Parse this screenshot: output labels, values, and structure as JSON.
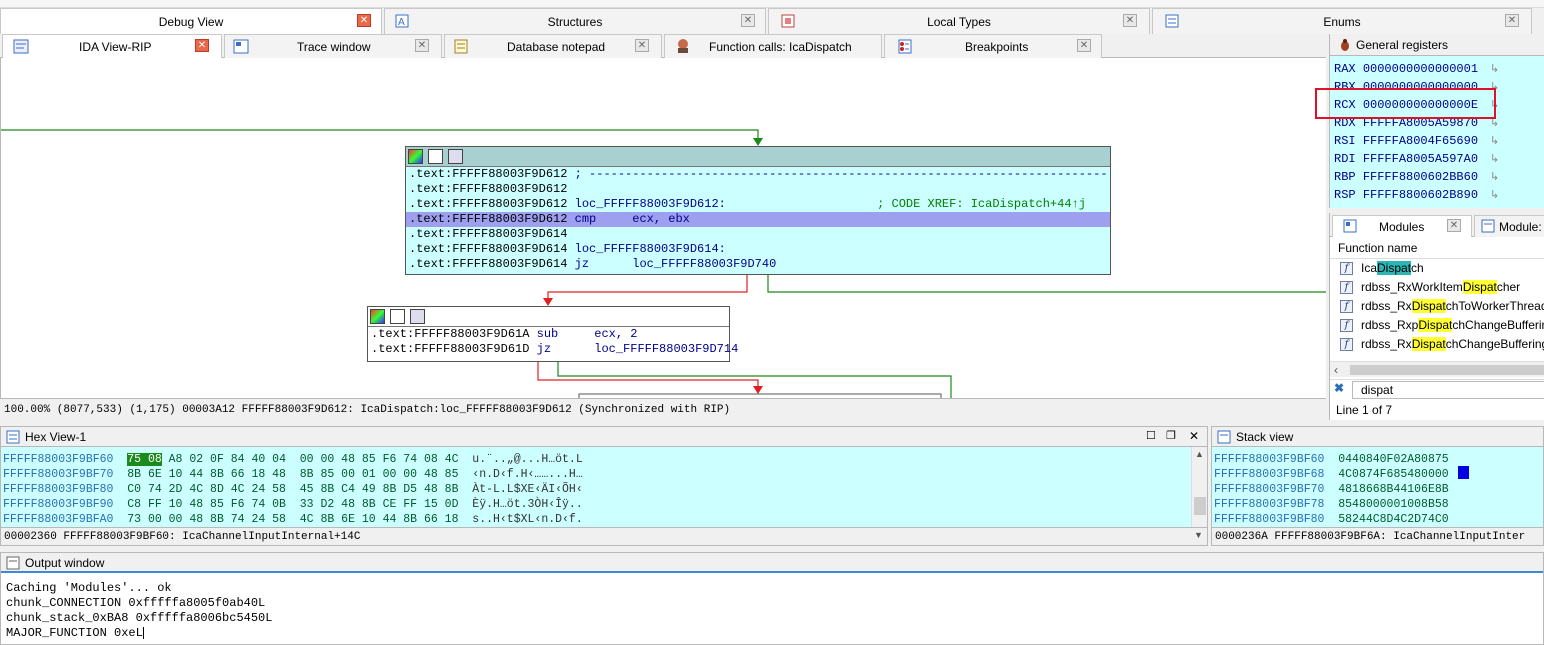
{
  "top_tabs": [
    {
      "label": "Debug View",
      "active": true
    },
    {
      "label": "Structures"
    },
    {
      "label": "Local Types"
    },
    {
      "label": "Enums"
    }
  ],
  "sub_tabs": [
    {
      "label": "IDA View-RIP",
      "active": true
    },
    {
      "label": "Trace window"
    },
    {
      "label": "Database notepad"
    },
    {
      "label": "Function calls: IcaDispatch"
    },
    {
      "label": "Breakpoints"
    }
  ],
  "graph": {
    "node1": [
      {
        "addr": ".text:FFFFF88003F9D612",
        "rest": " ; ------------------------------------------------------------------------"
      },
      {
        "addr": ".text:FFFFF88003F9D612",
        "rest": ""
      },
      {
        "addr": ".text:FFFFF88003F9D612",
        "rest": " loc_FFFFF88003F9D612:",
        "comment": "                     ; CODE XREF: IcaDispatch+44↑j"
      },
      {
        "addr": ".text:FFFFF88003F9D612",
        "rest": " cmp     ecx, ebx",
        "selected": true
      },
      {
        "addr": ".text:FFFFF88003F9D614",
        "rest": ""
      },
      {
        "addr": ".text:FFFFF88003F9D614",
        "rest": " loc_FFFFF88003F9D614:"
      },
      {
        "addr": ".text:FFFFF88003F9D614",
        "rest": " jz      loc_FFFFF88003F9D740"
      }
    ],
    "node2": [
      {
        "addr": ".text:FFFFF88003F9D61A",
        "rest": " sub     ecx, 2"
      },
      {
        "addr": ".text:FFFFF88003F9D61D",
        "rest": " jz      loc_FFFFF88003F9D714"
      }
    ],
    "status": "100.00% (8077,533) (1,175) 00003A12 FFFFF88003F9D612: IcaDispatch:loc_FFFFF88003F9D612 (Synchronized with RIP)"
  },
  "registers": {
    "title": "General registers",
    "rows": [
      {
        "name": "RAX",
        "value": "0000000000000001"
      },
      {
        "name": "RBX",
        "value": "0000000000000000"
      },
      {
        "name": "RCX",
        "value": "000000000000000E"
      },
      {
        "name": "RDX",
        "value": "FFFFFA8005A59870"
      },
      {
        "name": "RSI",
        "value": "FFFFFA8004F65690"
      },
      {
        "name": "RDI",
        "value": "FFFFFA8005A597A0"
      },
      {
        "name": "RBP",
        "value": "FFFFF8800602BB60"
      },
      {
        "name": "RSP",
        "value": "FFFFF8800602B890"
      }
    ]
  },
  "modules": {
    "tab1": "Modules",
    "tab2": "Module: I",
    "header": "Function name",
    "rows": [
      {
        "pre": "Ica",
        "hl": "Dispat",
        "post": "ch",
        "hlclass": "hlc"
      },
      {
        "pre": "rdbss_RxWorkItem",
        "hl": "Dispat",
        "post": "cher",
        "hlclass": "hl"
      },
      {
        "pre": "rdbss_Rx",
        "hl": "Dispat",
        "post": "chToWorkerThread",
        "hlclass": "hl"
      },
      {
        "pre": "rdbss_Rxp",
        "hl": "Dispat",
        "post": "chChangeBuffering",
        "hlclass": "hl"
      },
      {
        "pre": "rdbss_Rx",
        "hl": "Dispat",
        "post": "chChangeBufferingS",
        "hlclass": "hl"
      }
    ],
    "filter": "dispat",
    "line_info": "Line 1 of 7"
  },
  "hex": {
    "title": "Hex View-1",
    "rows": [
      {
        "addr": "FFFFF88003F9BF60",
        "sel": "75 08",
        "bytes": " A8 02 0F 84 40 04  00 00 48 85 F6 74 08 4C",
        "ascii": "u.¨..„@...H…öt.L"
      },
      {
        "addr": "FFFFF88003F9BF70",
        "sel": "",
        "bytes": "8B 6E 10 44 8B 66 18 48  8B 85 00 01 00 00 48 85",
        "ascii": "‹n.D‹f.H‹……...H…"
      },
      {
        "addr": "FFFFF88003F9BF80",
        "sel": "",
        "bytes": "C0 74 2D 4C 8D 4C 24 58  45 8B C4 49 8B D5 48 8B",
        "ascii": "Àt-L.L$XE‹ÄI‹ÕH‹"
      },
      {
        "addr": "FFFFF88003F9BF90",
        "sel": "",
        "bytes": "C8 FF 10 48 85 F6 74 0B  33 D2 48 8B CE FF 15 0D",
        "ascii": "Èÿ.H…öt.3ÒH‹Îÿ.."
      },
      {
        "addr": "FFFFF88003F9BFA0",
        "sel": "",
        "bytes": "73 00 00 48 8B 74 24 58  4C 8B 6E 10 44 8B 66 18",
        "ascii": "s..H‹t$XL‹n.D‹f."
      }
    ],
    "status": "00002360 FFFFF88003F9BF60: IcaChannelInputInternal+14C"
  },
  "stack": {
    "title": "Stack view",
    "rows": [
      {
        "addr": "FFFFF88003F9BF60",
        "value": "0440840F02A80875"
      },
      {
        "addr": "FFFFF88003F9BF68",
        "value": "4C0874F685480000"
      },
      {
        "addr": "FFFFF88003F9BF70",
        "value": "4818668B44106E8B"
      },
      {
        "addr": "FFFFF88003F9BF78",
        "value": "8548000001008B58"
      },
      {
        "addr": "FFFFF88003F9BF80",
        "value": "58244C8D4C2D74C0"
      }
    ],
    "status": "0000236A FFFFF88003F9BF6A: IcaChannelInputInter"
  },
  "output": {
    "title": "Output window",
    "lines": [
      "Caching 'Modules'... ok",
      "chunk_CONNECTION 0xfffffa8005f0ab40L",
      "chunk_stack_0xBA8 0xfffffa8006bc5450L",
      "MAJOR_FUNCTION 0xeL"
    ]
  },
  "colors": {
    "code_bg": "#ccffff",
    "selected_line": "#9f9fef",
    "highlight_box": "#e0102a",
    "edge_true": "#1a8a1a",
    "edge_false": "#e02020"
  }
}
